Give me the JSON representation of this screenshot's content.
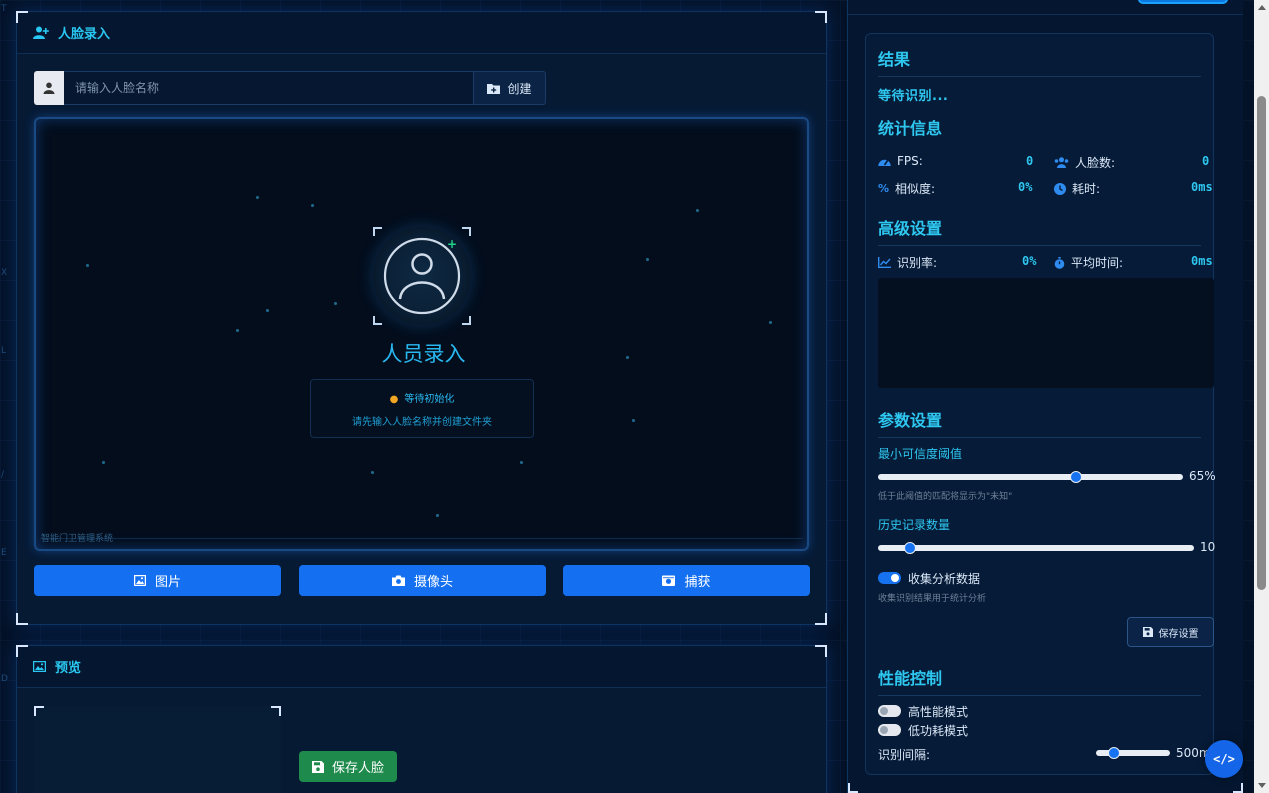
{
  "entry_panel": {
    "title": "人脸录入",
    "name_placeholder": "请输入人脸名称",
    "create_label": "创建",
    "video": {
      "title": "人员录入",
      "status": "等待初始化",
      "hint": "请先输入人脸名称并创建文件夹",
      "system_label": "智能门卫管理系统"
    },
    "buttons": {
      "image": "图片",
      "camera": "摄像头",
      "capture": "捕获"
    }
  },
  "preview_panel": {
    "title": "预览",
    "save_face_label": "保存人脸"
  },
  "results": {
    "title": "结果",
    "status": "等待识别...",
    "stats_title": "统计信息",
    "fps_label": "FPS:",
    "fps_value": "0",
    "faces_label": "人脸数:",
    "faces_value": "0",
    "similarity_label": "相似度:",
    "similarity_value": "0%",
    "time_label": "耗时:",
    "time_value": "0ms",
    "advanced_title": "高级设置",
    "recognition_rate_label": "识别率:",
    "recognition_rate_value": "0%",
    "avg_time_label": "平均时间:",
    "avg_time_value": "0ms",
    "params_title": "参数设置",
    "min_conf_label": "最小可信度阈值",
    "min_conf_value": "65%",
    "min_conf_fraction": 0.65,
    "min_conf_hint": "低于此阈值的匹配将显示为\"未知\"",
    "history_label": "历史记录数量",
    "history_value": "10",
    "history_fraction": 0.1,
    "collect_label": "收集分析数据",
    "collect_on": true,
    "collect_hint": "收集识别结果用于统计分析",
    "save_settings_label": "保存设置",
    "perf_title": "性能控制",
    "high_perf_label": "高性能模式",
    "high_perf_on": false,
    "low_power_label": "低功耗模式",
    "low_power_on": false,
    "interval_label": "识别间隔:",
    "interval_value": "500ms"
  },
  "colors": {
    "accent": "#2ec7f0",
    "primary_button": "#1470f0",
    "success_button": "#1e8a4b",
    "background": "#041227",
    "status_dot": "#f2a623"
  }
}
